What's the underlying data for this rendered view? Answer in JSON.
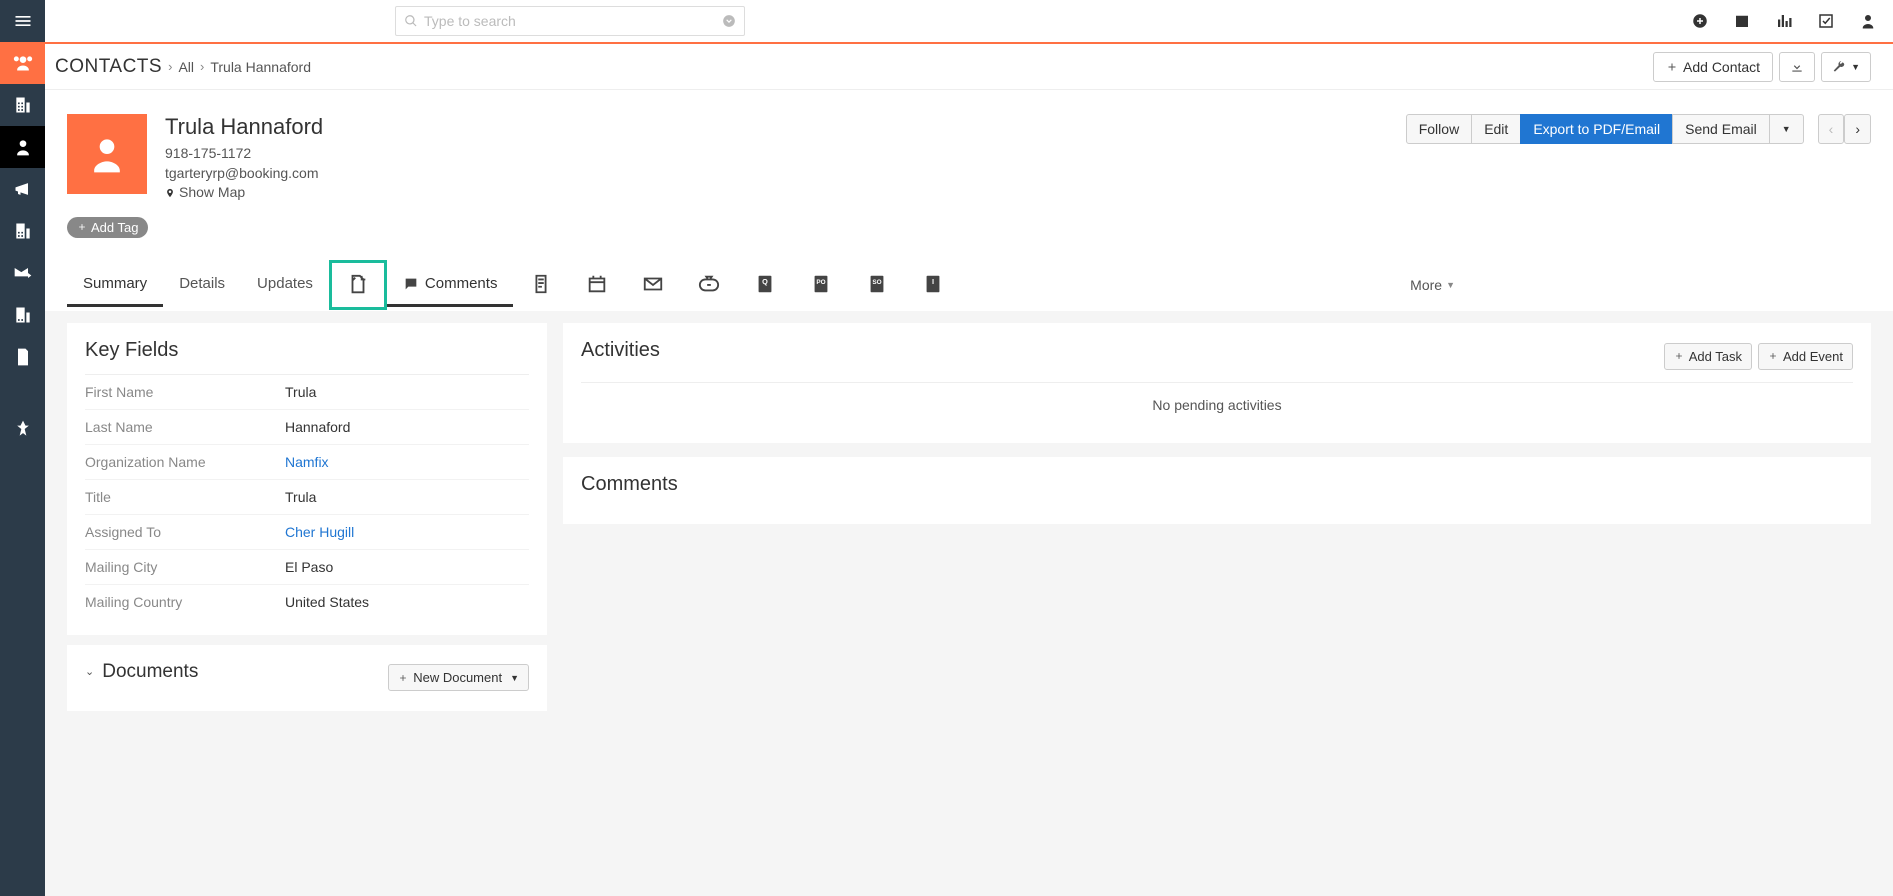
{
  "search": {
    "placeholder": "Type to search"
  },
  "breadcrumb": {
    "section": "CONTACTS",
    "all": "All",
    "name": "Trula Hannaford"
  },
  "addContact": "Add Contact",
  "contact": {
    "name": "Trula Hannaford",
    "phone": "918-175-1172",
    "email": "tgarteryrp@booking.com",
    "showMap": "Show Map"
  },
  "addTag": "Add Tag",
  "actions": {
    "follow": "Follow",
    "edit": "Edit",
    "export": "Export to PDF/Email",
    "sendEmail": "Send Email"
  },
  "tabs": {
    "summary": "Summary",
    "details": "Details",
    "updates": "Updates",
    "comments": "Comments",
    "more": "More"
  },
  "keyFields": {
    "title": "Key Fields",
    "rows": {
      "firstName": {
        "label": "First Name",
        "value": "Trula"
      },
      "lastName": {
        "label": "Last Name",
        "value": "Hannaford"
      },
      "orgName": {
        "label": "Organization Name",
        "value": "Namfix"
      },
      "titleField": {
        "label": "Title",
        "value": "Trula"
      },
      "assignedTo": {
        "label": "Assigned To",
        "value": "Cher Hugill"
      },
      "mailingCity": {
        "label": "Mailing City",
        "value": "El Paso"
      },
      "mailingCountry": {
        "label": "Mailing Country",
        "value": "United States"
      }
    }
  },
  "activities": {
    "title": "Activities",
    "addTask": "Add Task",
    "addEvent": "Add Event",
    "empty": "No pending activities"
  },
  "commentsPanel": {
    "title": "Comments"
  },
  "documents": {
    "title": "Documents",
    "newDoc": "New Document"
  }
}
